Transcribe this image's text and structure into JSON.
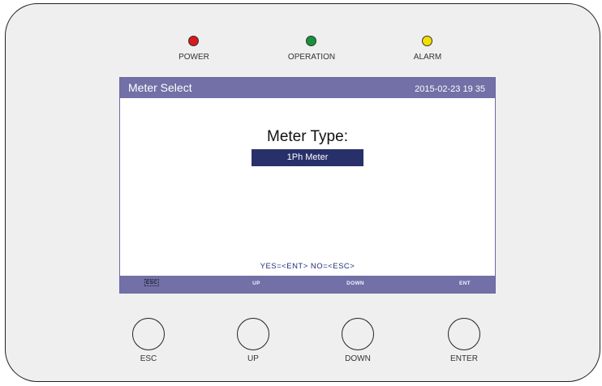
{
  "leds": {
    "power": {
      "label": "POWER",
      "color": "#d91a1a"
    },
    "operation": {
      "label": "OPERATION",
      "color": "#15943a"
    },
    "alarm": {
      "label": "ALARM",
      "color": "#f2e000"
    }
  },
  "screen": {
    "title": "Meter Select",
    "datetime": "2015-02-23   19 35",
    "heading": "Meter Type:",
    "selected_value": "1Ph Meter",
    "prompt": "YES=<ENT>  NO=<ESC>",
    "softkeys": {
      "esc": "ESC",
      "up": "UP",
      "down": "DOWN",
      "ent": "ENT"
    }
  },
  "buttons": {
    "esc": "ESC",
    "up": "UP",
    "down": "DOWN",
    "enter": "ENTER"
  },
  "colors": {
    "header_bar": "#7270a6",
    "selection_box": "#28306a",
    "prompt_text": "#23307a"
  }
}
